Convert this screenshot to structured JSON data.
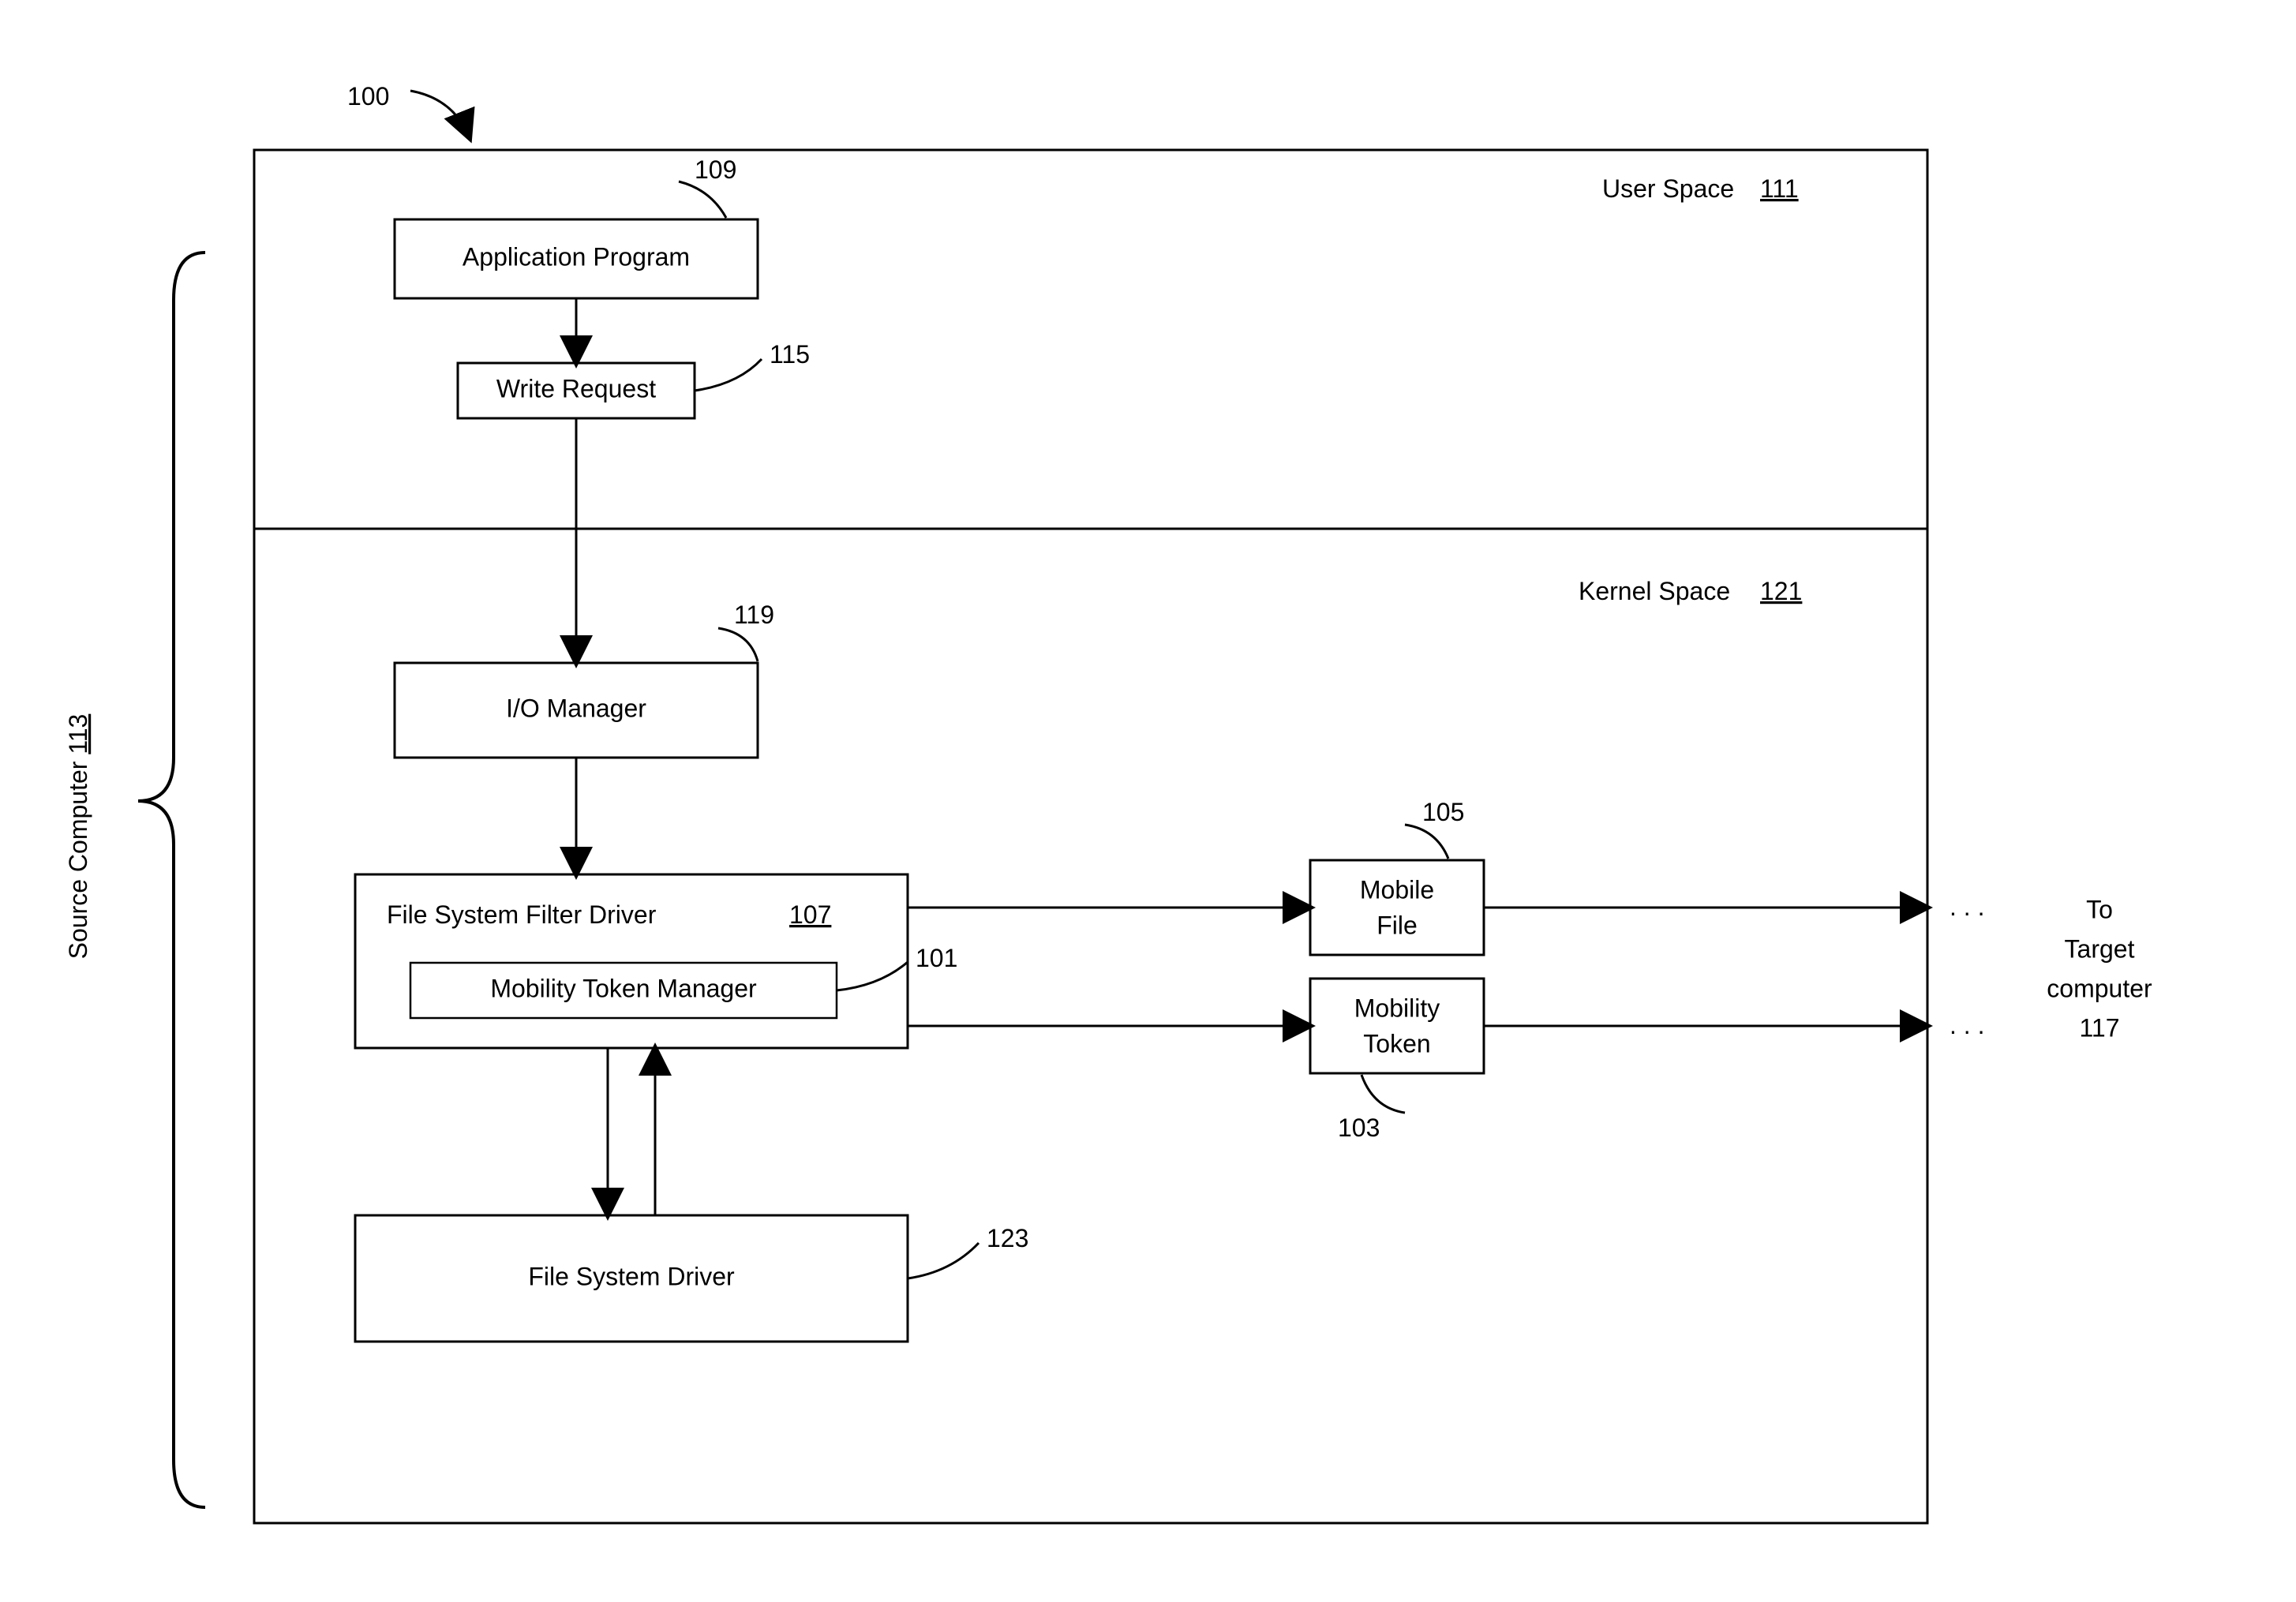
{
  "diagram": {
    "figureLabel": "100",
    "sourceComputerLabel": "Source Computer",
    "sourceComputerRef": "113",
    "userSpace": {
      "label": "User Space",
      "ref": "111"
    },
    "kernelSpace": {
      "label": "Kernel Space",
      "ref": "121"
    },
    "appProgram": {
      "label": "Application Program",
      "ref": "109"
    },
    "writeRequest": {
      "label": "Write Request",
      "ref": "115"
    },
    "ioManager": {
      "label": "I/O Manager",
      "ref": "119"
    },
    "fsFilterDriver": {
      "label": "File System Filter Driver",
      "ref": "107"
    },
    "mobilityTokenManager": {
      "label": "Mobility Token Manager",
      "ref": "101"
    },
    "fsDriver": {
      "label": "File System Driver",
      "ref": "123"
    },
    "mobileFile": {
      "line1": "Mobile",
      "line2": "File",
      "ref": "105"
    },
    "mobilityToken": {
      "line1": "Mobility",
      "line2": "Token",
      "ref": "103"
    },
    "target": {
      "line1": "To",
      "line2": "Target",
      "line3": "computer",
      "ref": "117"
    },
    "dots": ". . ."
  }
}
